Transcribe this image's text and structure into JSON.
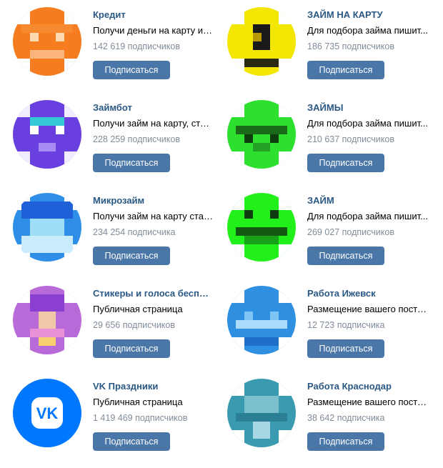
{
  "subscribe_label": "Подписаться",
  "groups": [
    {
      "name": "Кредит",
      "description": "Получи деньги на карту ил...",
      "subscribers": "142 619 подписчиков",
      "avatar_icon": "orange-pixel-face-icon",
      "avatar_color": "#f57c1f"
    },
    {
      "name": "ЗАЙМ НА КАРТУ",
      "description": "Для подбора займа пишит...",
      "subscribers": "186 735 подписчиков",
      "avatar_icon": "yellow-dollar-coin-icon",
      "avatar_color": "#f3e600"
    },
    {
      "name": "Займбот",
      "description": "Получи займ на карту, став...",
      "subscribers": "228 259 подписчиков",
      "avatar_icon": "purple-robot-icon",
      "avatar_color": "#6a3fe0"
    },
    {
      "name": "ЗАЙМЫ",
      "description": "Для подбора займа пишит...",
      "subscribers": "210 637 подписчиков",
      "avatar_icon": "green-pixel-face-icon",
      "avatar_color": "#2ee02e"
    },
    {
      "name": "Микрозайм",
      "description": "Получи займ на карту став...",
      "subscribers": "234 254 подписчика",
      "avatar_icon": "blue-cloud-icon",
      "avatar_color": "#2f8fe8"
    },
    {
      "name": "ЗАЙМ",
      "description": "Для подбора займа пишит...",
      "subscribers": "269 027 подписчиков",
      "avatar_icon": "green-pixel-face-icon",
      "avatar_color": "#22f01a"
    },
    {
      "name": "Стикеры и голоса бесплат...",
      "description": "Публичная страница",
      "subscribers": "29 656 подписчиков",
      "avatar_icon": "purple-character-icon",
      "avatar_color": "#b86ad8"
    },
    {
      "name": "Работа Ижевск",
      "description": "Размещение вашего поста ...",
      "subscribers": "12 723 подписчика",
      "avatar_icon": "blue-pixel-icon",
      "avatar_color": "#2f8fe0"
    },
    {
      "name": "VK Праздники",
      "description": "Публичная страница",
      "subscribers": "1 419 469 подписчиков",
      "avatar_icon": "vk-logo-icon",
      "avatar_color": "#0077ff",
      "logo_text": "VK"
    },
    {
      "name": "Работа Краснодар",
      "description": "Размещение вашего поста ...",
      "subscribers": "38 642 подписчика",
      "avatar_icon": "teal-pixel-icon",
      "avatar_color": "#3a9ab0"
    }
  ]
}
